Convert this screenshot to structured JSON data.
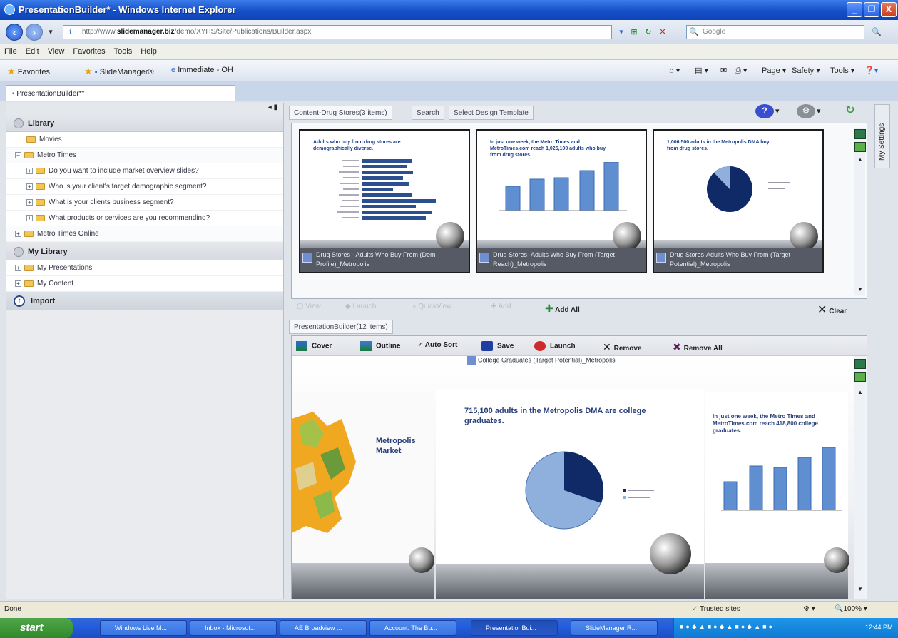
{
  "window": {
    "title": "PresentationBuilder* - Windows Internet Explorer",
    "minimize": "_",
    "restore": "❐",
    "close": "X"
  },
  "address": {
    "prefix": "http://www.",
    "domain": "slidemanager.biz",
    "path": "/demo/XYHS/Site/Publications/Builder.aspx",
    "search_placeholder": "Google"
  },
  "menu": [
    "File",
    "Edit",
    "View",
    "Favorites",
    "Tools",
    "Help"
  ],
  "favorites": {
    "label": "Favorites",
    "items": [
      "SlideManager®",
      "Immediate - OH"
    ]
  },
  "commands": [
    "Page ▾",
    "Safety ▾",
    "Tools ▾"
  ],
  "tab": {
    "label": "PresentationBuilder**"
  },
  "left": {
    "library": "Library",
    "movies": "Movies",
    "metro_times": "Metro Times",
    "questions": [
      "Do you want to include market overview slides?",
      "Who is your client's target demographic segment?",
      "What is your clients business segment?",
      "What products or services are you recommending?"
    ],
    "metro_online": "Metro Times Online",
    "my_library": "My Library",
    "my_presentations": "My Presentations",
    "my_content": "My Content",
    "import": "Import"
  },
  "content_tabs": [
    "Content-Drug Stores(3 items)",
    "Search",
    "Select Design Template"
  ],
  "my_settings": "My Settings",
  "slides": [
    {
      "title": "Adults who buy from drug stores are demographically diverse.",
      "caption": "Drug Stores - Adults Who Buy From (Dem Profile)_Metropolis"
    },
    {
      "title": "In just one week, the Metro Times and MetroTimes.com reach 1,025,100 adults who buy from drug stores.",
      "caption": "Drug Stores- Adults Who Buy From (Target Reach)_Metropolis"
    },
    {
      "title": "1,006,500 adults in the Metropolis DMA buy from drug stores.",
      "caption": "Drug Stores-Adults Who Buy From (Target Potential)_Metropolis"
    }
  ],
  "actions": {
    "view": "View",
    "launch": "Launch",
    "add_all": "Add All",
    "clear": "Clear",
    "add": "Add",
    "quickview": "QuickView"
  },
  "builder": {
    "tab": "PresentationBuilder(12 items)",
    "tools": [
      "Cover",
      "Outline",
      "Auto Sort",
      "Save",
      "Launch",
      "Remove",
      "Remove All"
    ],
    "current_caption": "College Graduates (Target Potential)_Metropolis",
    "center_title": "715,100 adults in the Metropolis DMA are college graduates.",
    "left_title": "Metropolis Market",
    "right_title": "In just one week, the Metro Times and MetroTimes.com reach 418,800 college graduates."
  },
  "status": {
    "left": "Done",
    "zone": "Trusted sites",
    "zoom": "100%"
  },
  "taskbar": {
    "start": "start",
    "tasks": [
      "Windows Live M...",
      "Inbox - Microsof...",
      "AE Broadview ...",
      "Account: The Bu...",
      "PresentationBui...",
      "SlideManager R..."
    ],
    "clock": "12:44 PM"
  },
  "colors": {
    "bar_blue": "#2b4f8f",
    "pie_dark": "#0f2a66",
    "pie_light": "#8fb0dc"
  }
}
